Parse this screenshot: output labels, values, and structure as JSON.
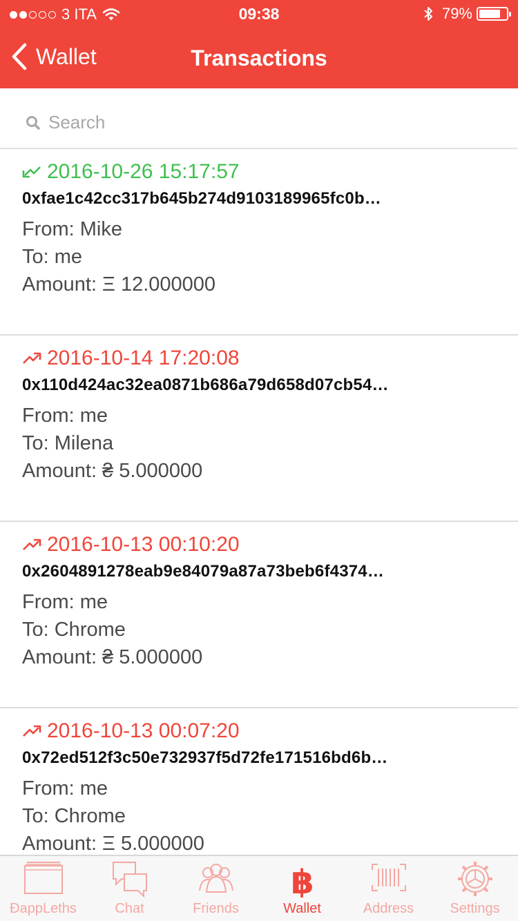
{
  "status_bar": {
    "signal_bars_filled": 2,
    "signal_bars_total": 5,
    "carrier": "3 ITA",
    "time": "09:38",
    "battery_percent": "79%",
    "battery_level": 0.79
  },
  "nav": {
    "back_label": "Wallet",
    "title": "Transactions"
  },
  "search": {
    "placeholder": "Search"
  },
  "colors": {
    "accent": "#ef453b",
    "incoming": "#3fbf4f",
    "outgoing": "#ef453b",
    "tab_inactive": "#f4a8a2"
  },
  "transactions": [
    {
      "direction": "incoming",
      "date": "2016-10-26 15:17:57",
      "hash": "0xfae1c42cc317b645b274d9103189965fc0b…",
      "from": "From: Mike",
      "to": "To: me",
      "amount": "Amount: Ξ 12.000000"
    },
    {
      "direction": "outgoing",
      "date": "2016-10-14 17:20:08",
      "hash": "0x110d424ac32ea0871b686a79d658d07cb54…",
      "from": "From: me",
      "to": "To: Milena",
      "amount": "Amount: ₴ 5.000000"
    },
    {
      "direction": "outgoing",
      "date": "2016-10-13 00:10:20",
      "hash": "0x2604891278eab9e84079a87a73beb6f4374…",
      "from": "From: me",
      "to": "To: Chrome",
      "amount": "Amount: ₴ 5.000000"
    },
    {
      "direction": "outgoing",
      "date": "2016-10-13 00:07:20",
      "hash": "0x72ed512f3c50e732937f5d72fe171516bd6b…",
      "from": "From: me",
      "to": "To: Chrome",
      "amount": "Amount: Ξ 5.000000"
    }
  ],
  "tabs": [
    {
      "label": "ÐappLeths",
      "icon": "browser-window-icon",
      "active": false
    },
    {
      "label": "Chat",
      "icon": "chat-bubbles-icon",
      "active": false
    },
    {
      "label": "Friends",
      "icon": "friends-icon",
      "active": false
    },
    {
      "label": "Wallet",
      "icon": "bitcoin-icon",
      "active": true
    },
    {
      "label": "Address",
      "icon": "barcode-icon",
      "active": false
    },
    {
      "label": "Settings",
      "icon": "gear-icon",
      "active": false
    }
  ]
}
